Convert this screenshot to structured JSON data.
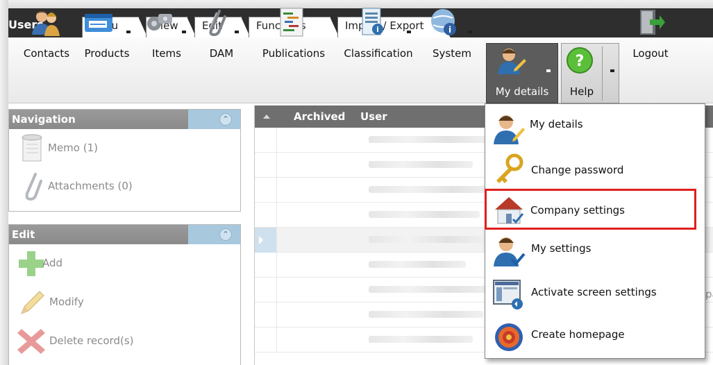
{
  "app": {
    "title": "Users"
  },
  "tabs": [
    {
      "label": "Menu"
    },
    {
      "label": "View"
    },
    {
      "label": "Edit"
    },
    {
      "label": "Functions"
    },
    {
      "label": "Import / Export"
    }
  ],
  "toolbar": {
    "items": [
      {
        "label": "Contacts",
        "icon": "contacts-icon"
      },
      {
        "label": "Products",
        "icon": "products-icon"
      },
      {
        "label": "Items",
        "icon": "items-icon"
      },
      {
        "label": "DAM",
        "icon": "paperclip-icon"
      },
      {
        "label": "Publications",
        "icon": "publications-icon"
      },
      {
        "label": "Classification",
        "icon": "classification-icon"
      },
      {
        "label": "System",
        "icon": "globe-info-icon"
      },
      {
        "label": "My details",
        "icon": "user-edit-icon"
      },
      {
        "label": "Help",
        "icon": "help-icon"
      },
      {
        "label": "Logout",
        "icon": "logout-door-icon"
      }
    ]
  },
  "navigation": {
    "title": "Navigation",
    "items": [
      {
        "label": "Memo (1)",
        "icon": "memo-scroll-icon"
      },
      {
        "label": "Attachments (0)",
        "icon": "paperclip-icon"
      }
    ]
  },
  "edit_panel": {
    "title": "Edit",
    "items": [
      {
        "label": "Add",
        "icon": "add-plus-icon"
      },
      {
        "label": "Modify",
        "icon": "pencil-icon"
      },
      {
        "label": "Delete record(s)",
        "icon": "delete-x-icon"
      }
    ]
  },
  "grid": {
    "columns": [
      "Archived",
      "User"
    ],
    "partial_text": "pa"
  },
  "dropdown": {
    "items": [
      {
        "label": "My details",
        "icon": "user-edit-icon"
      },
      {
        "label": "Change password",
        "icon": "key-icon"
      },
      {
        "label": "Company settings",
        "icon": "company-house-icon"
      },
      {
        "label": "My settings",
        "icon": "user-check-icon"
      },
      {
        "label": "Activate screen settings",
        "icon": "screen-settings-icon"
      },
      {
        "label": "Create homepage",
        "icon": "target-icon"
      }
    ]
  },
  "colors": {
    "highlight_border": "#e01e1e",
    "tabbar_bg": "#2e2e2e",
    "panel_head": "#8a8a8a",
    "grid_head": "#6f6f6f"
  }
}
